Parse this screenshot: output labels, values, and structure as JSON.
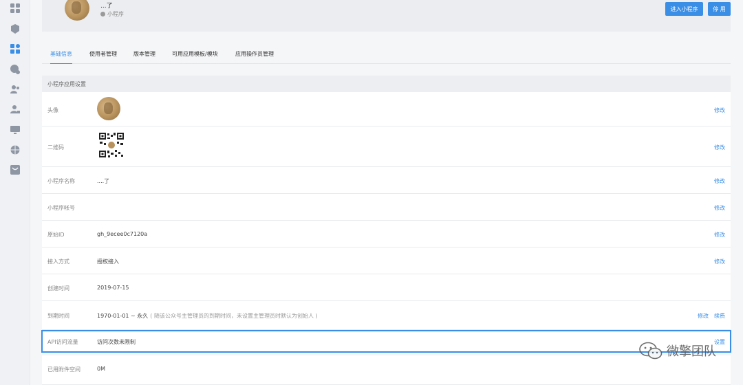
{
  "sidebar": {
    "icons": [
      "apps-grid-icon",
      "box-icon",
      "modules-icon",
      "palette-icon",
      "users-icon",
      "user-lock-icon",
      "monitor-icon",
      "globe-icon",
      "store-icon"
    ]
  },
  "header": {
    "app_name": "...了",
    "app_type": "小程序",
    "enter_button": "进入小程序",
    "stop_button": "停 用"
  },
  "tabs": [
    {
      "label": "基础信息",
      "active": true
    },
    {
      "label": "使用者管理",
      "active": false
    },
    {
      "label": "版本管理",
      "active": false
    },
    {
      "label": "可用应用模板/模块",
      "active": false
    },
    {
      "label": "应用操作员管理",
      "active": false
    }
  ],
  "section_title": "小程序应用设置",
  "rows": {
    "avatar": {
      "label": "头像",
      "action": "修改"
    },
    "qrcode": {
      "label": "二维码",
      "action": "修改"
    },
    "name": {
      "label": "小程序名称",
      "value": "....了",
      "action": "修改"
    },
    "account": {
      "label": "小程序帐号",
      "value": "",
      "action": "修改"
    },
    "original_id": {
      "label": "原始ID",
      "value": "gh_9ecee0c7120a",
      "action": "修改"
    },
    "access": {
      "label": "接入方式",
      "value": "授权接入",
      "action": "修改"
    },
    "created": {
      "label": "创建时间",
      "value": "2019-07-15"
    },
    "expire": {
      "label": "到期时间",
      "value": "1970-01-01 ~ 永久",
      "hint": "( 随该公众号主管理员的到期时间，未设置主管理员时默认为创始人 )",
      "action": "修改",
      "action2": "续费"
    },
    "api": {
      "label": "API访问流量",
      "value": "访问次数未限制",
      "action": "设置"
    },
    "space": {
      "label": "已用附件空间",
      "value": "0M"
    }
  },
  "watermark": "微擎团队"
}
